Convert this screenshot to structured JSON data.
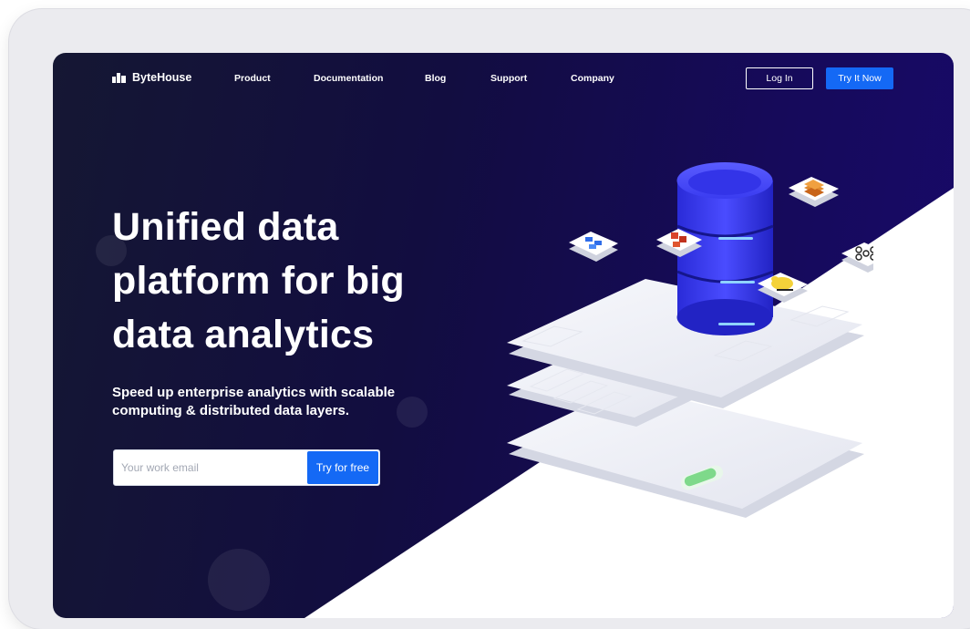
{
  "nav": {
    "brand": "ByteHouse",
    "links": [
      "Product",
      "Documentation",
      "Blog",
      "Support",
      "Company"
    ],
    "login_label": "Log In",
    "try_now_label": "Try It Now"
  },
  "hero": {
    "headline_lines": [
      "Unified data",
      "platform for big",
      "data analytics"
    ],
    "subheadline_lines": [
      "Speed up enterprise analytics with scalable",
      "computing & distributed data layers."
    ],
    "email_placeholder": "Your work email",
    "cta_label": "Try for free"
  },
  "icons": {
    "logo": "bytehouse-logo-icon",
    "illustration": [
      "database-cylinder-icon",
      "integration-tile-icon",
      "aws-tile-icon",
      "kafka-tile-icon",
      "hadoop-tile-icon",
      "toggle-switch-icon"
    ]
  },
  "colors": {
    "background_dark": "#151733",
    "background_purple": "#18096a",
    "accent_blue": "#1469f5",
    "database_blue": "#3a3cf0",
    "toggle_green": "#7ed98a"
  }
}
